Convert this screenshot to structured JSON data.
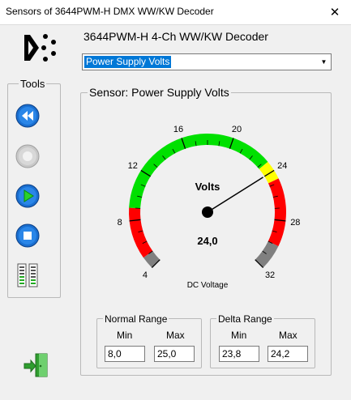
{
  "window": {
    "title": "Sensors of 3644PWM-H  DMX WW/KW Decoder",
    "close_glyph": "✕"
  },
  "header": {
    "device_title": "3644PWM-H  4-Ch WW/KW Decoder"
  },
  "sensor_select": {
    "value": "Power Supply Volts"
  },
  "tools": {
    "label": "Tools",
    "buttons": [
      "rewind-icon",
      "record-icon",
      "play-icon",
      "stop-icon",
      "levels-icon"
    ]
  },
  "sensor_panel": {
    "title": "Sensor: Power Supply Volts",
    "gauge": {
      "label": "Volts",
      "value_text": "24,0",
      "value": 24.0,
      "units": "DC Voltage",
      "min": 4,
      "max": 32,
      "tick_labels": [
        "4",
        "8",
        "12",
        "16",
        "20",
        "24",
        "28",
        "32"
      ],
      "zones": [
        {
          "from": 4,
          "to": 5,
          "color": "#808080"
        },
        {
          "from": 5,
          "to": 9,
          "color": "#ff0000"
        },
        {
          "from": 9,
          "to": 23.2,
          "color": "#00e000"
        },
        {
          "from": 23.2,
          "to": 24.7,
          "color": "#ffff00"
        },
        {
          "from": 24.7,
          "to": 30,
          "color": "#ff0000"
        },
        {
          "from": 30,
          "to": 32,
          "color": "#808080"
        }
      ]
    }
  },
  "normal_range": {
    "label": "Normal Range",
    "min_label": "Min",
    "max_label": "Max",
    "min": "8,0",
    "max": "25,0"
  },
  "delta_range": {
    "label": "Delta Range",
    "min_label": "Min",
    "max_label": "Max",
    "min": "23,8",
    "max": "24,2"
  },
  "footer": {
    "icon": "exit-door-icon"
  }
}
